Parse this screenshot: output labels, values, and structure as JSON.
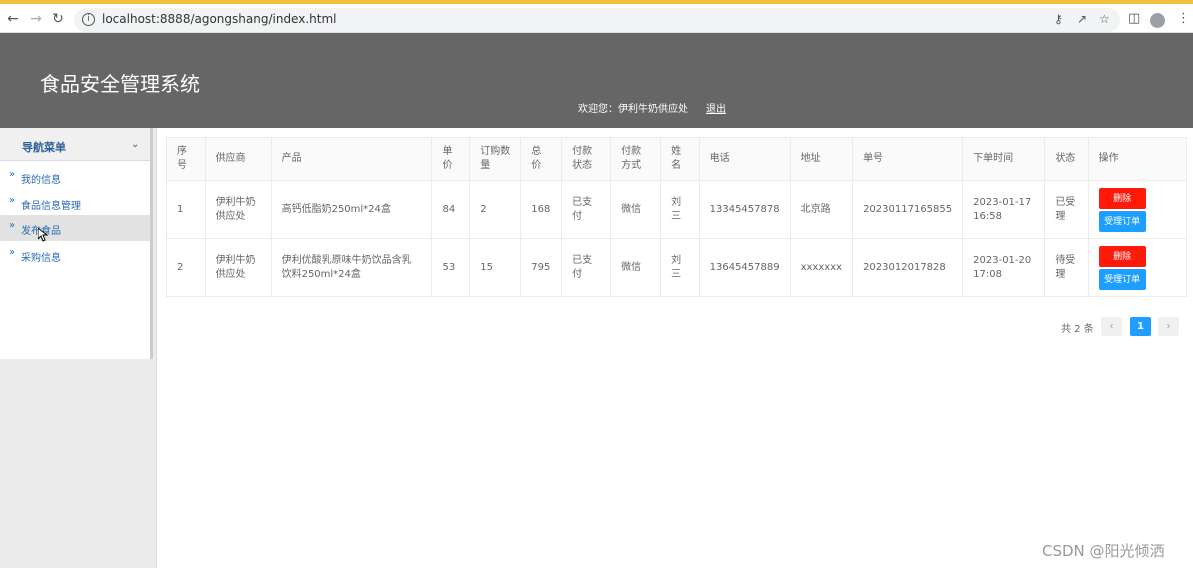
{
  "browser": {
    "url": "localhost:8888/agongshang/index.html",
    "icons": [
      "back-icon",
      "forward-icon",
      "reload-icon",
      "info-icon",
      "key-icon",
      "share-icon",
      "star-icon",
      "sidepanel-icon",
      "profile-icon",
      "menu-icon"
    ]
  },
  "header": {
    "title": "食品安全管理系统",
    "welcome": "欢迎您：伊利牛奶供应处",
    "logout": "退出"
  },
  "sidebar": {
    "menu_title": "导航菜单",
    "items": [
      {
        "label": "我的信息"
      },
      {
        "label": "食品信息管理"
      },
      {
        "label": "发布食品"
      },
      {
        "label": "采购信息"
      }
    ]
  },
  "table": {
    "headers": [
      "序号",
      "供应商",
      "产品",
      "单价",
      "订购数量",
      "总价",
      "付款状态",
      "付款方式",
      "姓名",
      "电话",
      "地址",
      "单号",
      "下单时间",
      "状态",
      "操作"
    ],
    "rows": [
      {
        "index": "1",
        "supplier": "伊利牛奶供应处",
        "product": "高钙低脂奶250ml*24盒",
        "price": "84",
        "qty": "2",
        "total": "168",
        "pay_status": "已支付",
        "pay_method": "微信",
        "name": "刘三",
        "phone": "13345457878",
        "address": "北京路",
        "order_no": "20230117165855",
        "time": "2023-01-17 16:58",
        "status": "已受理",
        "delete": "删除",
        "accept": "受理订单"
      },
      {
        "index": "2",
        "supplier": "伊利牛奶供应处",
        "product": "伊利优酸乳原味牛奶饮品含乳饮料250ml*24盒",
        "price": "53",
        "qty": "15",
        "total": "795",
        "pay_status": "已支付",
        "pay_method": "微信",
        "name": "刘三",
        "phone": "13645457889",
        "address": "xxxxxxx",
        "order_no": "2023012017828",
        "time": "2023-01-20 17:08",
        "status": "待受理",
        "delete": "删除",
        "accept": "受理订单"
      }
    ]
  },
  "pager": {
    "total": "共 2 条",
    "current": "1"
  },
  "watermark": "CSDN @阳光倾洒",
  "colors": {
    "header_bg": "#666666",
    "delete_btn": "#ff1a0a",
    "accept_btn": "#1e9fff",
    "page_active": "#1e9fff"
  }
}
